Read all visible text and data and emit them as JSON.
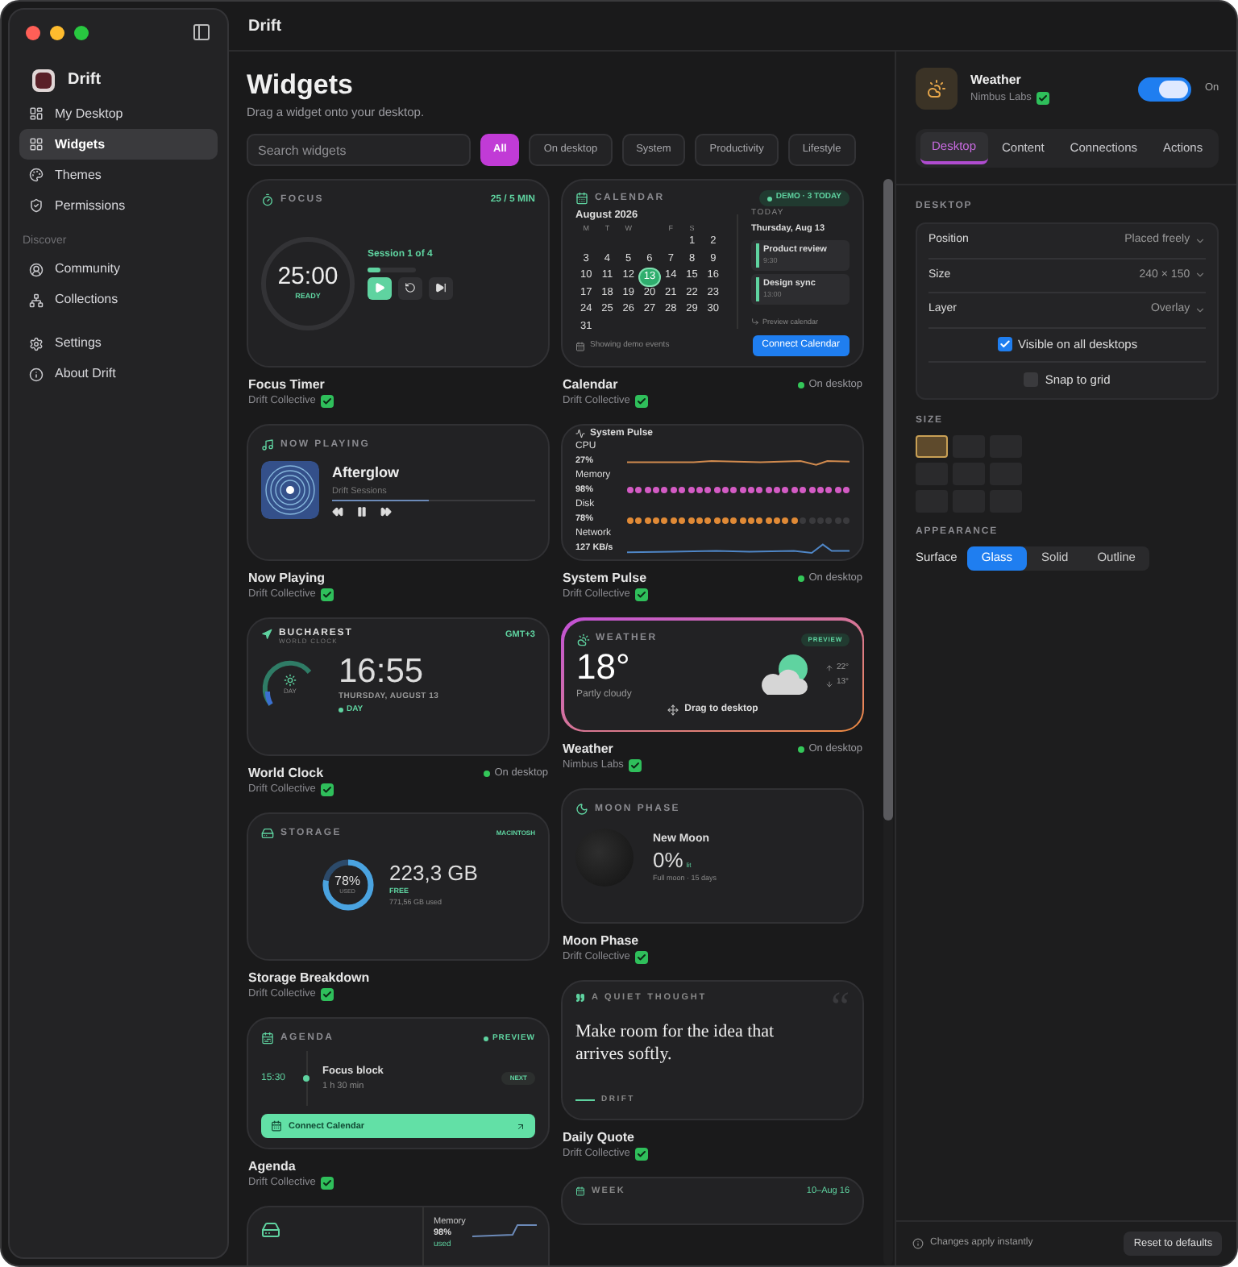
{
  "window": {
    "title": "Drift"
  },
  "sidebar": {
    "app_name": "Drift",
    "groups": [
      {
        "items": [
          {
            "label": "My Desktop",
            "kind": "desktop",
            "selected": false
          },
          {
            "label": "Widgets",
            "kind": "widgets",
            "selected": true
          },
          {
            "label": "Themes",
            "kind": "themes",
            "selected": false
          },
          {
            "label": "Permissions",
            "kind": "permissions",
            "selected": false
          }
        ]
      },
      {
        "heading": "Discover",
        "items": [
          {
            "label": "Community",
            "kind": "community",
            "selected": false
          },
          {
            "label": "Collections",
            "kind": "collections",
            "selected": false
          }
        ]
      },
      {
        "items": [
          {
            "label": "Settings",
            "kind": "settings",
            "selected": false
          },
          {
            "label": "About Drift",
            "kind": "about",
            "selected": false
          }
        ]
      }
    ]
  },
  "header": {
    "title": "Widgets",
    "subtitle": "Drag a widget onto your desktop."
  },
  "search": {
    "placeholder": "Search widgets"
  },
  "filters": [
    {
      "label": "All",
      "selected": true
    },
    {
      "label": "On desktop",
      "selected": false
    },
    {
      "label": "System",
      "selected": false
    },
    {
      "label": "Productivity",
      "selected": false
    },
    {
      "label": "Lifestyle",
      "selected": false
    }
  ],
  "columns": [
    [
      {
        "kind": "focus",
        "label": "FOCUS",
        "badge": "25 / 5 MIN",
        "time": "25:00",
        "state": "READY",
        "session": "Session 1 of 4",
        "level": 0.25,
        "name": "Focus Timer",
        "author": "Drift Collective",
        "verified": true,
        "selected": false
      },
      {
        "kind": "music",
        "label": "NOW PLAYING",
        "track": "Afterglow",
        "album": "Drift Sessions",
        "level": 0.48,
        "name": "Now Playing",
        "author": "Drift Collective",
        "verified": true,
        "selected": false
      },
      {
        "kind": "clock",
        "city": "BUCHAREST",
        "label": "WORLD CLOCK",
        "badge": "GMT+3",
        "dial_label": "DAY",
        "time": "16:55",
        "date": "THURSDAY, AUGUST 13",
        "period": "DAY",
        "name": "World Clock",
        "author": "Drift Collective",
        "verified": true,
        "status": "On desktop",
        "selected": false
      },
      {
        "kind": "storage",
        "label": "STORAGE",
        "badge": "MACINTOSH",
        "percent": "78%",
        "percent_label": "USED",
        "level": 0.78,
        "size": "223,3 GB",
        "size_label": "FREE",
        "used": "771,56 GB used",
        "name": "Storage Breakdown",
        "author": "Drift Collective",
        "verified": true,
        "selected": false
      },
      {
        "kind": "agenda",
        "label": "AGENDA",
        "badge": "PREVIEW",
        "time": "15:30",
        "event": "Focus block",
        "duration": "1 h 30 min",
        "tag": "NEXT",
        "button": "Connect Calendar",
        "name": "Agenda",
        "author": "Drift Collective",
        "verified": true,
        "selected": false
      },
      {
        "kind": "mac",
        "metric": "Memory",
        "value": "98%",
        "unit": "used"
      }
    ],
    [
      {
        "kind": "calendar",
        "label": "CALENDAR",
        "badge": "DEMO · 3 TODAY",
        "month": "August 2026",
        "weekdays": [
          {
            "kind": "letter",
            "label": "M"
          },
          {
            "kind": "letter",
            "label": "T"
          },
          {
            "kind": "letter",
            "label": "W"
          },
          {
            "kind": "blank"
          },
          {
            "kind": "letter",
            "label": "F"
          },
          {
            "kind": "letter",
            "label": "S"
          },
          {
            "kind": "blank"
          }
        ],
        "weeks": [
          [
            {
              "day": "1",
              "selected": false
            },
            {
              "day": "2",
              "selected": false
            }
          ],
          [
            {
              "day": "3",
              "selected": false
            },
            {
              "day": "4",
              "selected": false
            },
            {
              "day": "5",
              "selected": false
            },
            {
              "day": "6",
              "selected": false
            },
            {
              "day": "7",
              "selected": false
            },
            {
              "day": "8",
              "selected": false
            },
            {
              "day": "9",
              "selected": false
            }
          ],
          [
            {
              "day": "10",
              "selected": false
            },
            {
              "day": "11",
              "selected": false
            },
            {
              "day": "12",
              "selected": false
            },
            {
              "day": "13",
              "selected": true
            },
            {
              "day": "14",
              "selected": false
            },
            {
              "day": "15",
              "selected": false
            },
            {
              "day": "16",
              "selected": false
            }
          ],
          [
            {
              "day": "17",
              "selected": false
            },
            {
              "day": "18",
              "selected": false
            },
            {
              "day": "19",
              "selected": false
            },
            {
              "day": "20",
              "selected": false
            },
            {
              "day": "21",
              "selected": false
            },
            {
              "day": "22",
              "selected": false
            },
            {
              "day": "23",
              "selected": false
            }
          ],
          [
            {
              "day": "24",
              "selected": false
            },
            {
              "day": "25",
              "selected": false
            },
            {
              "day": "26",
              "selected": false
            },
            {
              "day": "27",
              "selected": false
            },
            {
              "day": "28",
              "selected": false
            },
            {
              "day": "29",
              "selected": false
            },
            {
              "day": "30",
              "selected": false
            }
          ],
          [
            {
              "day": "31",
              "selected": false
            }
          ]
        ],
        "today_label": "TODAY",
        "today": "Thursday, Aug 13",
        "events": [
          {
            "title": "Product review",
            "time": "9:30"
          },
          {
            "title": "Design sync",
            "time": "13:00"
          }
        ],
        "preview_link": "Preview calendar",
        "note": "Showing demo events",
        "button": "Connect Calendar",
        "name": "Calendar",
        "author": "Drift Collective",
        "verified": true,
        "status": "On desktop",
        "selected": false
      },
      {
        "kind": "pulse",
        "label": "System Pulse",
        "metrics": [
          {
            "name": "CPU",
            "value": "27%",
            "kind": "line",
            "color": "#d08a4e"
          },
          {
            "name": "Memory",
            "value": "98%",
            "kind": "dots",
            "color": "#d35bc4",
            "level": 1
          },
          {
            "name": "Disk",
            "value": "78%",
            "kind": "dots",
            "color": "#e08a36",
            "level": 0.78
          },
          {
            "name": "Network",
            "value": "127 KB/s",
            "kind": "line",
            "color": "#4f86c6"
          }
        ],
        "name": "System Pulse",
        "author": "Drift Collective",
        "verified": true,
        "status": "On desktop",
        "selected": false
      },
      {
        "kind": "weather",
        "label": "WEATHER",
        "badge": "PREVIEW",
        "temp": "18°",
        "condition": "Partly cloudy",
        "high": "22°",
        "low": "13°",
        "action": "Drag to desktop",
        "name": "Weather",
        "author": "Nimbus Labs",
        "verified": true,
        "status": "On desktop",
        "selected": true
      },
      {
        "kind": "moon",
        "label": "MOON PHASE",
        "phase": "New Moon",
        "percent": "0%",
        "unit": "lit",
        "next": "Full moon · 15 days",
        "name": "Moon Phase",
        "author": "Drift Collective",
        "verified": true,
        "selected": false
      },
      {
        "kind": "quote",
        "label": "A QUIET THOUGHT",
        "mark": "“",
        "text": "Make room for the idea that arrives softly.",
        "source": "DRIFT",
        "name": "Daily Quote",
        "author": "Drift Collective",
        "verified": true,
        "selected": false
      },
      {
        "kind": "week",
        "label": "WEEK",
        "range": "10–Aug 16"
      }
    ]
  ],
  "panel": {
    "name": "Weather",
    "author": "Nimbus Labs",
    "verified": true,
    "enabled": true,
    "toggle_label": "On",
    "tabs": [
      {
        "label": "Desktop",
        "selected": true
      },
      {
        "label": "Content",
        "selected": false
      },
      {
        "label": "Connections",
        "selected": false
      },
      {
        "label": "Actions",
        "selected": false
      }
    ],
    "desktop_heading": "DESKTOP",
    "settings": [
      {
        "label": "Position",
        "value": "Placed freely"
      },
      {
        "label": "Size",
        "value": "240 × 150"
      },
      {
        "label": "Layer",
        "value": "Overlay"
      }
    ],
    "checkboxes": [
      {
        "label": "Visible on all desktops",
        "checked": true
      },
      {
        "label": "Snap to grid",
        "checked": false
      }
    ],
    "size_heading": "SIZE",
    "size_grid": [
      {
        "selected": true
      },
      {
        "selected": false
      },
      {
        "selected": false
      },
      {
        "selected": false
      },
      {
        "selected": false
      },
      {
        "selected": false
      },
      {
        "selected": false
      },
      {
        "selected": false
      },
      {
        "selected": false
      }
    ],
    "appearance_heading": "APPEARANCE",
    "surface_label": "Surface",
    "surface_options": [
      {
        "label": "Glass",
        "selected": true
      },
      {
        "label": "Solid",
        "selected": false
      },
      {
        "label": "Outline",
        "selected": false
      }
    ],
    "footer_note": "Changes apply instantly",
    "reset_button": "Reset to defaults"
  }
}
